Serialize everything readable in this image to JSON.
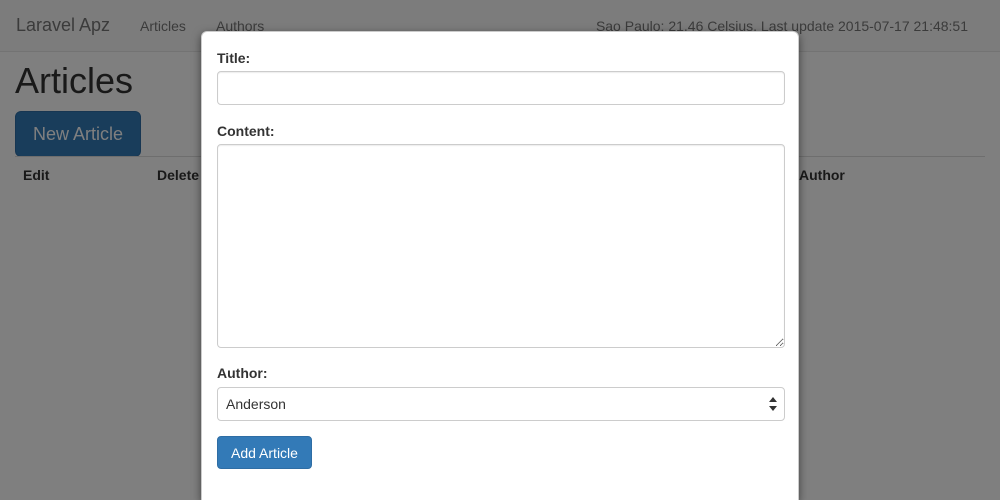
{
  "navbar": {
    "brand": "Laravel Apz",
    "links": [
      "Articles",
      "Authors"
    ],
    "weather": "Sao Paulo: 21.46 Celsius. Last update 2015-07-17 21:48:51"
  },
  "page": {
    "title": "Articles",
    "new_article_label": "New Article",
    "table_headers": {
      "edit": "Edit",
      "delete": "Delete",
      "author": "Author"
    }
  },
  "modal": {
    "title_label": "Title:",
    "title_value": "",
    "content_label": "Content:",
    "content_value": "",
    "author_label": "Author:",
    "author_selected": "Anderson",
    "submit_label": "Add Article"
  },
  "colors": {
    "primary": "#337ab7",
    "backdrop": "rgba(0,0,0,0.5)"
  },
  "icons": {
    "select_arrows": "updown-arrows-icon"
  }
}
